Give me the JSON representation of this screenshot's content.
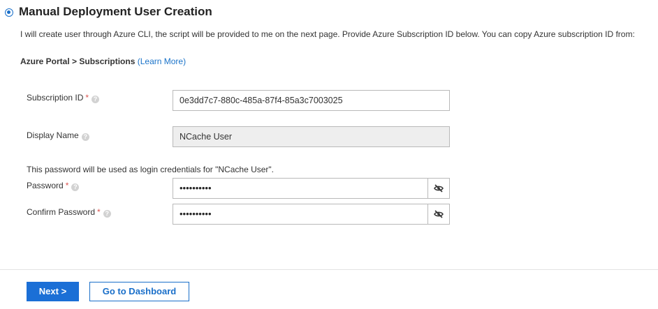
{
  "section": {
    "title": "Manual Deployment User Creation",
    "description": "I will create user through Azure CLI, the script will be provided to me on the next page. Provide Azure Subscription ID below. You can copy Azure subscription ID from:",
    "path_text": "Azure Portal > Subscriptions",
    "learn_more": "(Learn More)"
  },
  "fields": {
    "subscription": {
      "label": "Subscription ID",
      "required_mark": "*",
      "value": "0e3dd7c7-880c-485a-87f4-85a3c7003025"
    },
    "display_name": {
      "label": "Display Name",
      "value": "NCache User"
    },
    "password_note": "This password will be used as login credentials for \"NCache User\".",
    "password": {
      "label": "Password",
      "required_mark": "*",
      "masked": "••••••••••"
    },
    "confirm_password": {
      "label": "Confirm Password",
      "required_mark": "*",
      "masked": "••••••••••"
    }
  },
  "help_glyph": "?",
  "buttons": {
    "next": "Next >",
    "dashboard": "Go to Dashboard"
  },
  "icons": {
    "radio": "radio-selected-icon",
    "help": "help-icon",
    "eye": "eye-slash-icon"
  },
  "colors": {
    "accent": "#1b6fd6",
    "required": "#d9534f",
    "link": "#1a73c9"
  }
}
